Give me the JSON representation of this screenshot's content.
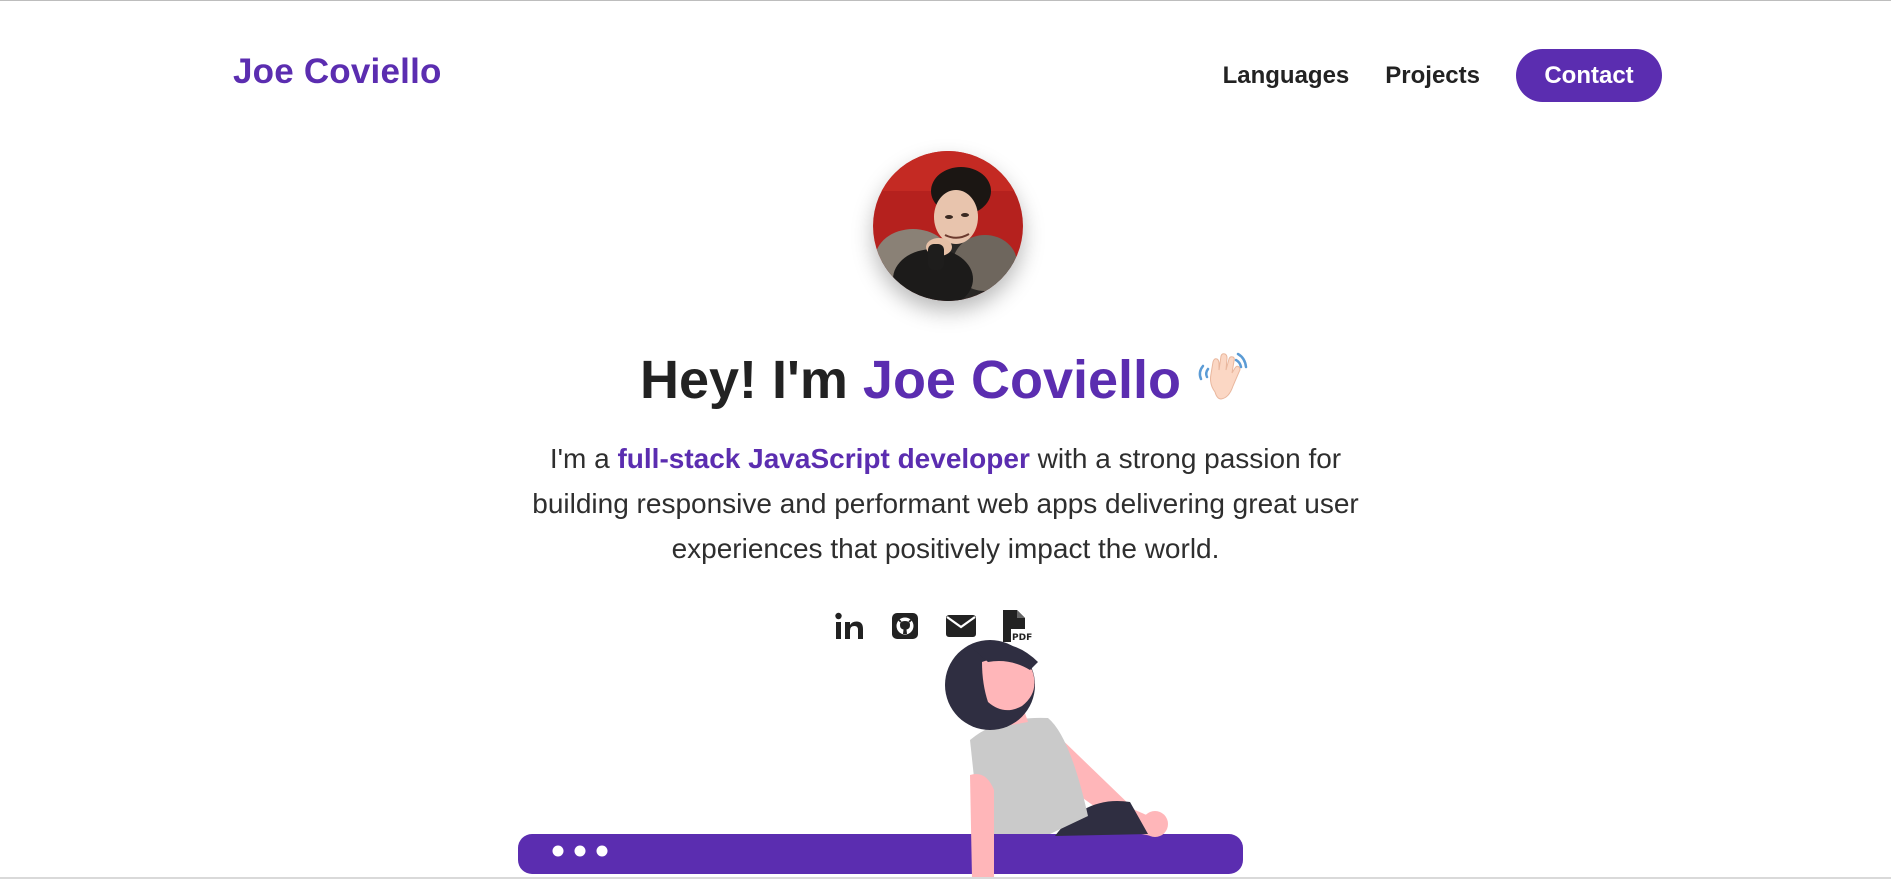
{
  "header": {
    "brand": "Joe Coviello",
    "nav": {
      "languages": "Languages",
      "projects": "Projects",
      "contact": "Contact"
    }
  },
  "hero": {
    "greeting": "Hey! I'm",
    "name": "Joe Coviello",
    "wave_icon": "waving-hand-emoji",
    "intro_prefix": "I'm a",
    "intro_highlight": "full-stack JavaScript developer",
    "intro_rest": "with a strong passion for building responsive and performant web apps delivering great user experiences that positively impact the world."
  },
  "socials": [
    {
      "icon": "linkedin-icon"
    },
    {
      "icon": "github-icon"
    },
    {
      "icon": "email-icon"
    },
    {
      "icon": "pdf-resume-icon"
    }
  ],
  "colors": {
    "accent": "#5b2db0",
    "text": "#222222",
    "background": "#ffffff"
  }
}
